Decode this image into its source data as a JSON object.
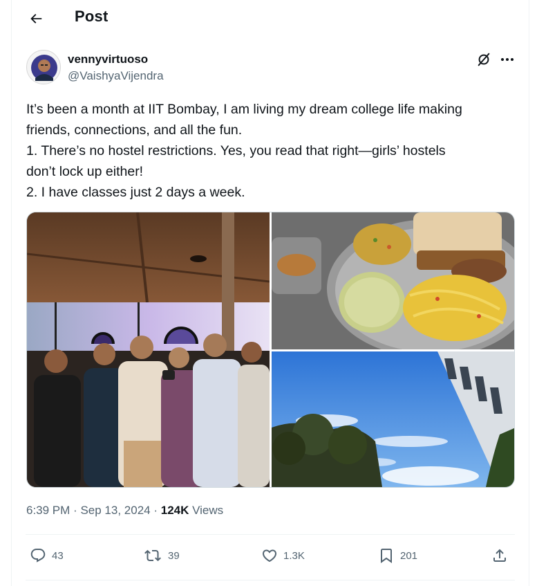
{
  "header": {
    "title": "Post",
    "back_icon": "arrow-left-icon"
  },
  "author": {
    "display_name": "vennyvirtuoso",
    "handle": "@VaishyaVijendra"
  },
  "tweet": {
    "lines": [
      "It’s been a month at IIT Bombay, I am living my dream college life making",
      "friends, connections, and all the fun.",
      "1. There’s no hostel restrictions. Yes, you read that right—girls’ hostels",
      "don’t lock up either!",
      "2. I have classes just 2 days a week."
    ]
  },
  "media": {
    "photos": [
      {
        "name": "group-photo",
        "description_icon": "photo"
      },
      {
        "name": "food-plate-photo",
        "description_icon": "photo"
      },
      {
        "name": "sky-building-photo",
        "description_icon": "photo"
      }
    ]
  },
  "meta": {
    "time": "6:39 PM",
    "separator": "·",
    "date": "Sep 13, 2024",
    "views_count": "124K",
    "views_label": "Views"
  },
  "actions": {
    "replies": "43",
    "reposts": "39",
    "likes": "1.3K",
    "bookmarks": "201"
  },
  "colors": {
    "text": "#0f1419",
    "secondary": "#536471",
    "border": "#eff3f4"
  }
}
